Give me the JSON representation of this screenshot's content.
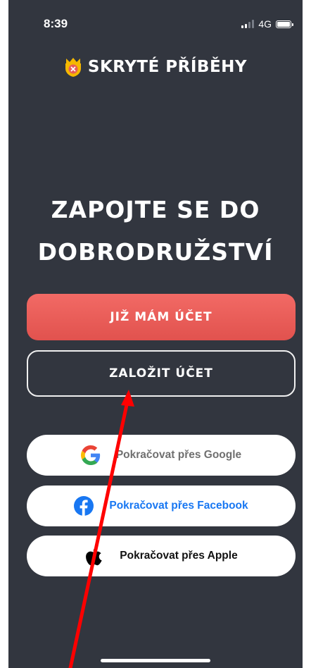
{
  "status_bar": {
    "time": "8:39",
    "network": "4G"
  },
  "brand": {
    "name": "SKRYTÉ PŘÍBĚHY"
  },
  "headline": {
    "line1": "ZAPOJTE SE DO",
    "line2": "DOBRODRUŽSTVÍ"
  },
  "buttons": {
    "login": "JIŽ MÁM ÚČET",
    "register": "ZALOŽIT ÚČET",
    "google": "Pokračovat přes Google",
    "facebook": "Pokračovat přes Facebook",
    "apple": "Pokračovat přes Apple"
  },
  "colors": {
    "background": "#32363f",
    "accent": "#e85d58",
    "facebook": "#1877f2",
    "annotation_arrow": "#ff0000"
  },
  "icons": [
    "crown-shield-logo-icon",
    "google-icon",
    "facebook-icon",
    "apple-icon"
  ]
}
